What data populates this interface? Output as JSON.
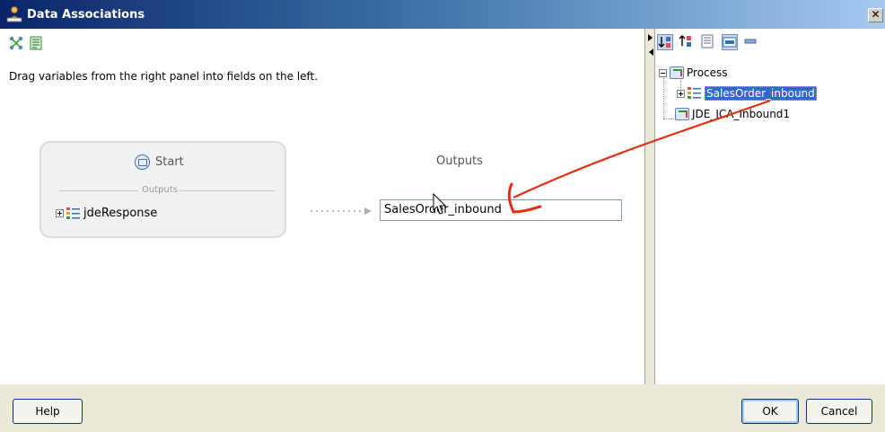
{
  "window": {
    "title": "Data Associations",
    "close_glyph": "✕"
  },
  "left_panel": {
    "instructions": "Drag variables from the right panel into fields on the left.",
    "start_node": {
      "title": "Start",
      "section_label": "Outputs",
      "variable": "jdeResponse"
    },
    "outputs_label": "Outputs",
    "output_field_value": "SalesOrder_inbound"
  },
  "right_panel": {
    "tree": {
      "root": "Process",
      "child": "SalesOrder_inbound",
      "sibling": "JDE_JCA_Inbound1"
    }
  },
  "buttons": {
    "help": "Help",
    "ok": "OK",
    "cancel": "Cancel"
  },
  "colors": {
    "title_bar": "#0a246a",
    "selection": "#316ac5",
    "annotation_arrow": "#e03010"
  },
  "icons": [
    "folder-icon",
    "mapping-icon",
    "script-icon",
    "envelope-icon",
    "struct-icon",
    "process-icon",
    "sort-ascending-icon",
    "sort-descending-icon",
    "details-icon",
    "view-mode-icon",
    "collapse-icon",
    "mouse-cursor-icon"
  ]
}
